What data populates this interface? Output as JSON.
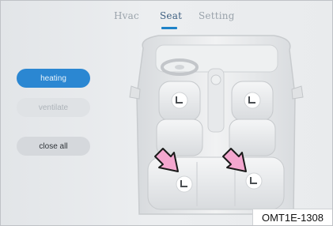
{
  "tabs": [
    {
      "label": "Hvac"
    },
    {
      "label": "Seat"
    },
    {
      "label": "Setting"
    }
  ],
  "side_buttons": {
    "heating": "heating",
    "ventilate": "ventilate",
    "close_all": "close all"
  },
  "figure_code": "OMT1E-1308",
  "colors": {
    "accent": "#2b87d2",
    "arrow_fill": "#f3a7cf",
    "arrow_stroke": "#1a1a1a"
  },
  "icons": {
    "seat_heat": "seat-heater-icon",
    "arrow": "pointer-arrow-icon"
  }
}
